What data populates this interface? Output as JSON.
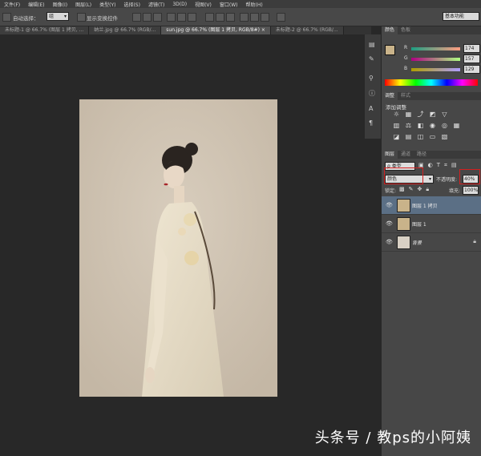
{
  "menu": [
    "文件(F)",
    "编辑(E)",
    "图像(I)",
    "图层(L)",
    "类型(Y)",
    "选择(S)",
    "滤镜(T)",
    "3D(D)",
    "视图(V)",
    "窗口(W)",
    "帮助(H)"
  ],
  "options": {
    "auto_select_label": "自动选择：",
    "auto_select_value": "组",
    "show_transform_label": "显示变换控件",
    "workspace": "基本功能"
  },
  "tabs": [
    {
      "label": "未标题-1 @ 66.7% (图层 1 拷贝, ...",
      "active": false
    },
    {
      "label": "纳兰.jpg @ 66.7% (RGB/...",
      "active": false
    },
    {
      "label": "sun.jpg @ 66.7% (图层 1 拷贝, RGB/8#) ×",
      "active": true
    },
    {
      "label": "未标题-2 @ 66.7% (RGB/...",
      "active": false
    }
  ],
  "color_panel": {
    "tabs": [
      "颜色",
      "色板"
    ],
    "swatch_color": "#c9b38a",
    "channels": [
      {
        "label": "R",
        "value": "174",
        "color": "#e04040"
      },
      {
        "label": "G",
        "value": "157",
        "color": "#40c040"
      },
      {
        "label": "B",
        "value": "129",
        "color": "#4060e0"
      }
    ]
  },
  "adjust_panel": {
    "tabs": [
      "调整",
      "样式"
    ],
    "title": "添加调整"
  },
  "layers_panel": {
    "tabs": [
      "图层",
      "通道",
      "路径"
    ],
    "kind_filter": "ρ 类型",
    "blend_mode": "颜色",
    "opacity_label": "不透明度:",
    "opacity_value": "40%",
    "lock_label": "锁定:",
    "fill_label": "填充:",
    "fill_value": "100%",
    "layers": [
      {
        "name": "图层 1 拷贝",
        "selected": true,
        "thumb": "#c9b38a"
      },
      {
        "name": "图层 1",
        "selected": false,
        "thumb": "#c9b38a"
      },
      {
        "name": "背景",
        "selected": false,
        "thumb": "#d8d0c4"
      }
    ]
  },
  "watermark": "头条号 / 教ps的小阿姨"
}
